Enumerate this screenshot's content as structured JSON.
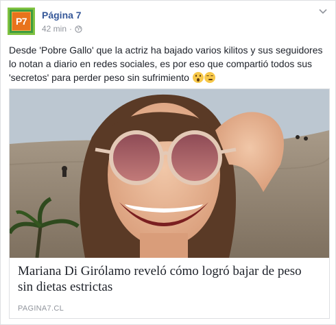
{
  "post": {
    "page_name": "Página 7",
    "avatar_text": "P7",
    "time": "42 min",
    "separator": "·",
    "text": "Desde 'Pobre Gallo' que la actriz ha bajado varios kilitos y sus seguidores lo notan a diario en redes sociales, es por eso que compartió todos sus 'secretos' para perder peso sin sufrimiento",
    "emojis": [
      "astonished-face-emoji",
      "smirking-face-emoji"
    ]
  },
  "link_card": {
    "headline": "Mariana Di Girólamo reveló cómo logró bajar de peso sin dietas estrictas",
    "domain": "PAGINA7.CL"
  },
  "colors": {
    "page_name": "#365899",
    "meta": "#90949c",
    "text": "#1d2129",
    "avatar_green": "#3f9b3f",
    "avatar_orange": "#e8731c"
  }
}
